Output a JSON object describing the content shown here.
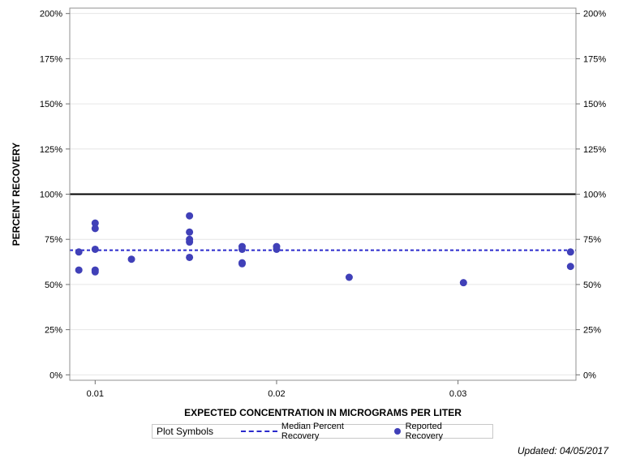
{
  "chart_data": {
    "type": "scatter",
    "xlabel": "EXPECTED CONCENTRATION IN MICROGRAMS PER LITER",
    "ylabel": "PERCENT RECOVERY",
    "xlim": [
      0.0086,
      0.0365
    ],
    "ylim": [
      -3,
      203
    ],
    "x_ticks": [
      0.01,
      0.02,
      0.03
    ],
    "x_tick_labels": [
      "0.01",
      "0.02",
      "0.03"
    ],
    "y_ticks": [
      0,
      25,
      50,
      75,
      100,
      125,
      150,
      175,
      200
    ],
    "y_tick_labels": [
      "0%",
      "25%",
      "50%",
      "75%",
      "100%",
      "125%",
      "150%",
      "175%",
      "200%"
    ],
    "grid": "horizontal",
    "reference_line": 100,
    "median": 69,
    "series": [
      {
        "name": "Reported Recovery",
        "color": "#4040b8",
        "points": [
          [
            0.0091,
            68
          ],
          [
            0.0091,
            58
          ],
          [
            0.01,
            84
          ],
          [
            0.01,
            81
          ],
          [
            0.01,
            69.5
          ],
          [
            0.01,
            58
          ],
          [
            0.01,
            57
          ],
          [
            0.012,
            64
          ],
          [
            0.0152,
            88
          ],
          [
            0.0152,
            79
          ],
          [
            0.0152,
            75
          ],
          [
            0.0152,
            73.5
          ],
          [
            0.0152,
            65
          ],
          [
            0.0181,
            71
          ],
          [
            0.0181,
            69.5
          ],
          [
            0.0181,
            62
          ],
          [
            0.0181,
            61.5
          ],
          [
            0.02,
            71
          ],
          [
            0.02,
            69.5
          ],
          [
            0.024,
            54
          ],
          [
            0.0303,
            51
          ],
          [
            0.0362,
            68
          ],
          [
            0.0362,
            60
          ]
        ]
      }
    ],
    "median_color": "#2a2acc",
    "reference_color": "#000000"
  },
  "legend": {
    "title": "Plot Symbols",
    "median_label": "Median Percent Recovery",
    "points_label": "Reported Recovery"
  },
  "footer": {
    "updated": "Updated: 04/05/2017"
  }
}
